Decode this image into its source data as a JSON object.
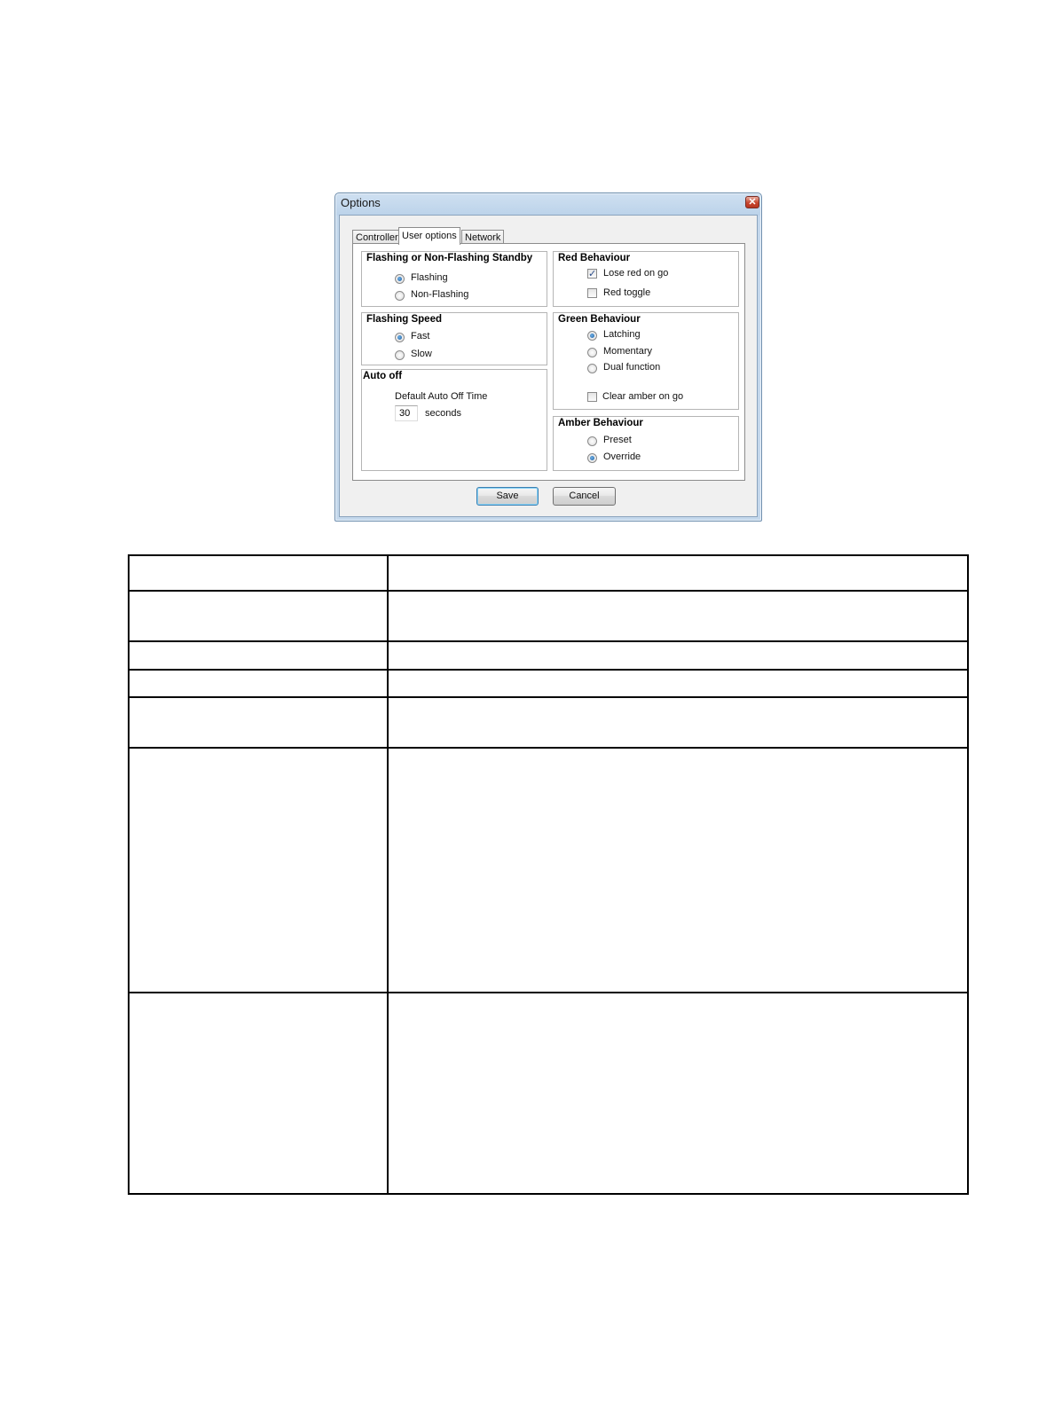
{
  "window": {
    "title": "Options",
    "close_glyph": "✕"
  },
  "tabs": [
    {
      "label": "Controller",
      "active": false
    },
    {
      "label": "User options",
      "active": true
    },
    {
      "label": "Network",
      "active": false
    }
  ],
  "flashing_group": {
    "title": "Flashing or Non-Flashing Standby",
    "options": [
      {
        "label": "Flashing",
        "checked": true
      },
      {
        "label": "Non-Flashing",
        "checked": false
      }
    ]
  },
  "speed_group": {
    "title": "Flashing Speed",
    "options": [
      {
        "label": "Fast",
        "checked": true
      },
      {
        "label": "Slow",
        "checked": false
      }
    ]
  },
  "auto_off_group": {
    "title": "Auto off",
    "field_label": "Default Auto Off Time",
    "value": "30",
    "unit": "seconds"
  },
  "red_group": {
    "title": "Red Behaviour",
    "options": [
      {
        "label": "Lose red on go",
        "checked": true
      },
      {
        "label": "Red toggle",
        "checked": false
      }
    ]
  },
  "green_group": {
    "title": "Green Behaviour",
    "options": [
      {
        "label": "Latching",
        "checked": true
      },
      {
        "label": "Momentary",
        "checked": false
      },
      {
        "label": "Dual function",
        "checked": false
      }
    ],
    "check": {
      "label": "Clear amber on go",
      "checked": false
    }
  },
  "amber_group": {
    "title": "Amber Behaviour",
    "options": [
      {
        "label": "Preset",
        "checked": false
      },
      {
        "label": "Override",
        "checked": true
      }
    ]
  },
  "buttons": {
    "save": "Save",
    "cancel": "Cancel"
  },
  "doc_table": {
    "rows": [
      [
        "",
        ""
      ],
      [
        "",
        ""
      ],
      [
        "",
        ""
      ],
      [
        "",
        ""
      ],
      [
        "",
        ""
      ],
      [
        "",
        ""
      ],
      [
        "",
        ""
      ]
    ]
  }
}
